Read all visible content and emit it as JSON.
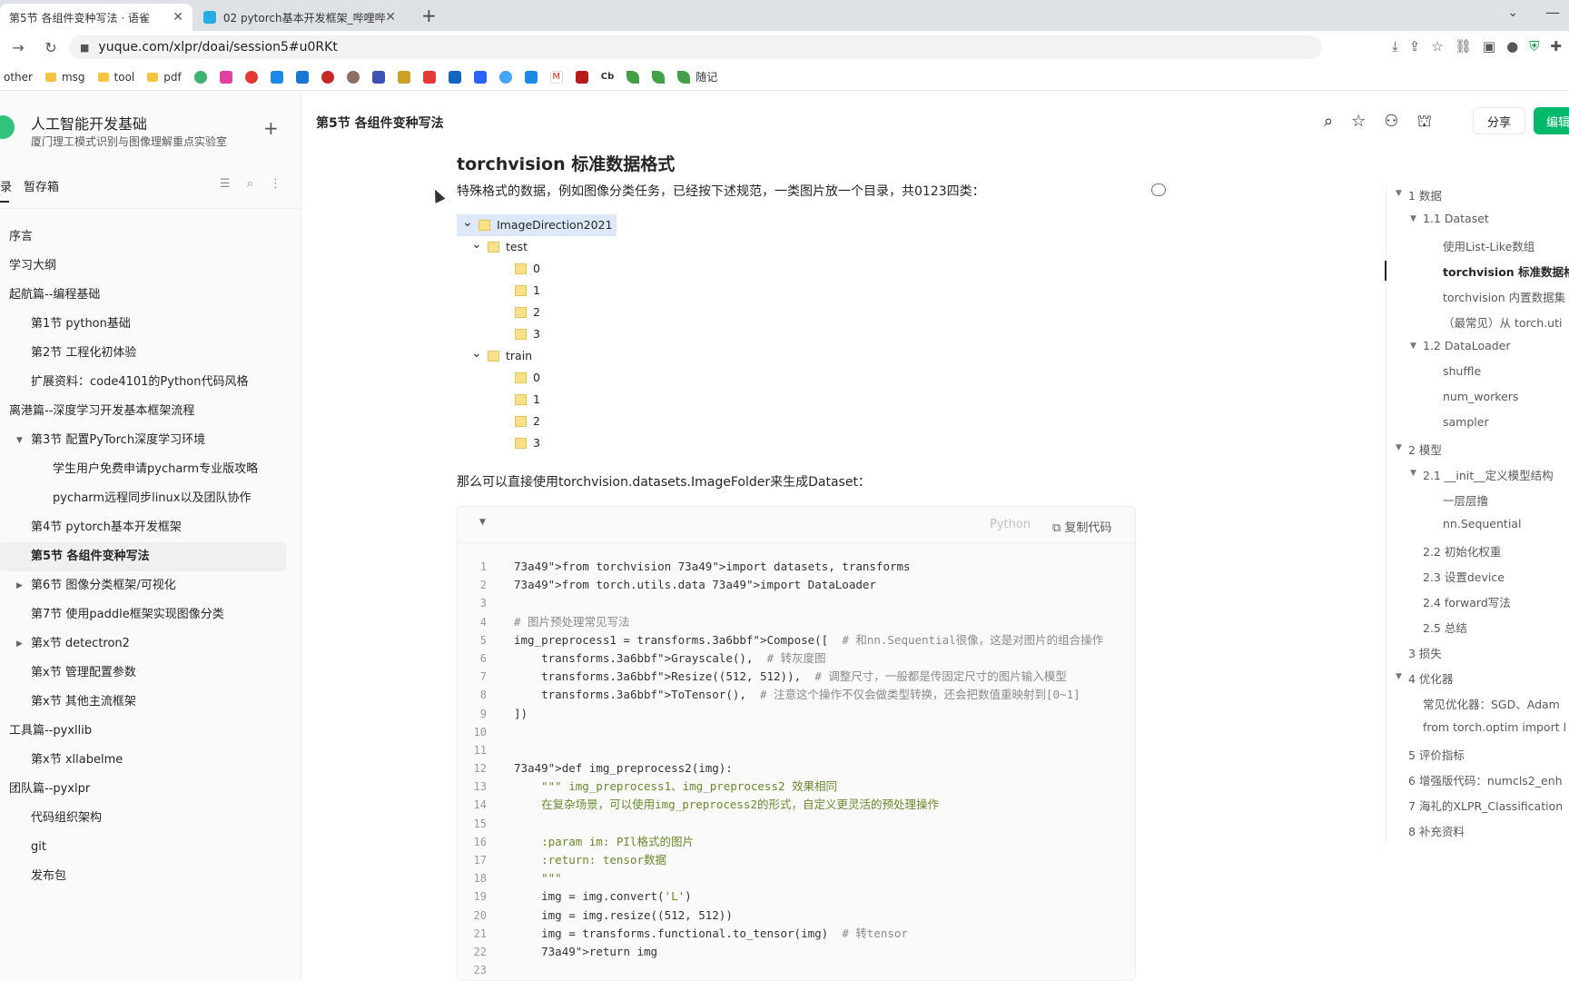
{
  "browser": {
    "tabs": [
      {
        "title": "第5节 各组件变种写法 · 语雀",
        "close": "✕",
        "active": true
      },
      {
        "title": "02 pytorch基本开发框架_哔哩哔",
        "close": "✕",
        "active": false
      }
    ],
    "new_tab": "+",
    "url": "yuque.com/xlpr/doai/session5#u0RKt",
    "bookmarks": [
      "other",
      "msg",
      "tool",
      "pdf",
      "随记"
    ],
    "bookmark_icon_labels": [
      "Cb"
    ]
  },
  "sidebar": {
    "title": "人工智能开发基础",
    "subtitle": "厦门理工模式识别与图像理解重点实验室",
    "tab_dir": "录",
    "tab_draft": "暂存箱",
    "items": [
      {
        "label": "序言",
        "level": 0,
        "arrow": ""
      },
      {
        "label": "学习大纲",
        "level": 0,
        "arrow": ""
      },
      {
        "label": "起航篇--编程基础",
        "level": 0,
        "arrow": ""
      },
      {
        "label": "第1节 python基础",
        "level": 1,
        "arrow": ""
      },
      {
        "label": "第2节 工程化初体验",
        "level": 1,
        "arrow": ""
      },
      {
        "label": "扩展资料：code4101的Python代码风格",
        "level": 1,
        "arrow": ""
      },
      {
        "label": "离港篇--深度学习开发基本框架流程",
        "level": 0,
        "arrow": ""
      },
      {
        "label": "第3节 配置PyTorch深度学习环境",
        "level": 1,
        "arrow": "▼"
      },
      {
        "label": "学生用户免费申请pycharm专业版攻略",
        "level": 2,
        "arrow": ""
      },
      {
        "label": "pycharm远程同步linux以及团队协作",
        "level": 2,
        "arrow": ""
      },
      {
        "label": "第4节 pytorch基本开发框架",
        "level": 1,
        "arrow": ""
      },
      {
        "label": "第5节 各组件变种写法",
        "level": 1,
        "arrow": "",
        "active": true
      },
      {
        "label": "第6节 图像分类框架/可视化",
        "level": 1,
        "arrow": "▶"
      },
      {
        "label": "第7节 使用paddle框架实现图像分类",
        "level": 1,
        "arrow": ""
      },
      {
        "label": "第x节 detectron2",
        "level": 1,
        "arrow": "▶"
      },
      {
        "label": "第x节 管理配置参数",
        "level": 1,
        "arrow": ""
      },
      {
        "label": "第x节 其他主流框架",
        "level": 1,
        "arrow": ""
      },
      {
        "label": "工具篇--pyxllib",
        "level": 0,
        "arrow": ""
      },
      {
        "label": "第x节 xllabelme",
        "level": 1,
        "arrow": ""
      },
      {
        "label": "团队篇--pyxlpr",
        "level": 0,
        "arrow": ""
      },
      {
        "label": "代码组织架构",
        "level": 1,
        "arrow": ""
      },
      {
        "label": "git",
        "level": 1,
        "arrow": ""
      },
      {
        "label": "发布包",
        "level": 1,
        "arrow": ""
      }
    ]
  },
  "header": {
    "doc_title": "第5节 各组件变种写法",
    "share": "分享",
    "edit": "编辑"
  },
  "doc": {
    "heading": "torchvision 标准数据格式",
    "para1": "特殊格式的数据，例如图像分类任务，已经按下述规范，一类图片放一个目录，共0123四类：",
    "para2": "那么可以直接使用torchvision.datasets.ImageFolder来生成Dataset：",
    "folder_tree": [
      {
        "label": "ImageDirection2021",
        "depth": 0,
        "chevron": true,
        "selected": true
      },
      {
        "label": "test",
        "depth": 1,
        "chevron": true
      },
      {
        "label": "0",
        "depth": 2
      },
      {
        "label": "1",
        "depth": 2
      },
      {
        "label": "2",
        "depth": 2
      },
      {
        "label": "3",
        "depth": 2
      },
      {
        "label": "train",
        "depth": 1,
        "chevron": true
      },
      {
        "label": "0",
        "depth": 2
      },
      {
        "label": "1",
        "depth": 2
      },
      {
        "label": "2",
        "depth": 2
      },
      {
        "label": "3",
        "depth": 2
      }
    ],
    "code": {
      "lang": "Python",
      "copy": "复制代码",
      "lines": [
        "from torchvision import datasets, transforms",
        "from torch.utils.data import DataLoader",
        "",
        "# 图片预处理常见写法",
        "img_preprocess1 = transforms.Compose([  # 和nn.Sequential很像，这是对图片的组合操作",
        "    transforms.Grayscale(),  # 转灰度图",
        "    transforms.Resize((512, 512)),  # 调整尺寸，一般都是传固定尺寸的图片输入模型",
        "    transforms.ToTensor(),  # 注意这个操作不仅会做类型转换，还会把数值重映射到[0~1]",
        "])",
        "",
        "",
        "def img_preprocess2(img):",
        "    \"\"\" img_preprocess1、img_preprocess2 效果相同",
        "    在复杂场景，可以使用img_preprocess2的形式，自定义更灵活的预处理操作",
        "",
        "    :param im: PIl格式的图片",
        "    :return: tensor数据",
        "    \"\"\"",
        "    img = img.convert('L')",
        "    img = img.resize((512, 512))",
        "    img = transforms.functional.to_tensor(img)  # 转tensor",
        "    return img",
        ""
      ]
    }
  },
  "outline": [
    {
      "label": "1 数据",
      "indent": 0,
      "arrow": "▼"
    },
    {
      "label": "1.1 Dataset",
      "indent": 1,
      "arrow": "▼"
    },
    {
      "label": "使用List-Like数组",
      "indent": 2,
      "arrow": ""
    },
    {
      "label": "torchvision 标准数据格",
      "indent": 2,
      "arrow": "",
      "active": true
    },
    {
      "label": "torchvision 内置数据集",
      "indent": 2,
      "arrow": ""
    },
    {
      "label": "（最常见）从 torch.uti",
      "indent": 2,
      "arrow": ""
    },
    {
      "label": "1.2 DataLoader",
      "indent": 1,
      "arrow": "▼"
    },
    {
      "label": "shuffle",
      "indent": 2,
      "arrow": ""
    },
    {
      "label": "num_workers",
      "indent": 2,
      "arrow": ""
    },
    {
      "label": "sampler",
      "indent": 2,
      "arrow": ""
    },
    {
      "label": "2 模型",
      "indent": 0,
      "arrow": "▼"
    },
    {
      "label": "2.1 __init__定义模型结构",
      "indent": 1,
      "arrow": "▼"
    },
    {
      "label": "一层层撸",
      "indent": 2,
      "arrow": ""
    },
    {
      "label": "nn.Sequential",
      "indent": 2,
      "arrow": ""
    },
    {
      "label": "2.2 初始化权重",
      "indent": 1,
      "arrow": ""
    },
    {
      "label": "2.3 设置device",
      "indent": 1,
      "arrow": ""
    },
    {
      "label": "2.4 forward写法",
      "indent": 1,
      "arrow": ""
    },
    {
      "label": "2.5 总结",
      "indent": 1,
      "arrow": ""
    },
    {
      "label": "3 损失",
      "indent": 0,
      "arrow": ""
    },
    {
      "label": "4 优化器",
      "indent": 0,
      "arrow": "▼"
    },
    {
      "label": "常见优化器：SGD、Adam",
      "indent": 1,
      "arrow": ""
    },
    {
      "label": "from torch.optim import l",
      "indent": 1,
      "arrow": ""
    },
    {
      "label": "5 评价指标",
      "indent": 0,
      "arrow": ""
    },
    {
      "label": "6 增强版代码：numcls2_enh",
      "indent": 0,
      "arrow": ""
    },
    {
      "label": "7 海礼的XLPR_Classification",
      "indent": 0,
      "arrow": ""
    },
    {
      "label": "8 补充资料",
      "indent": 0,
      "arrow": ""
    }
  ]
}
